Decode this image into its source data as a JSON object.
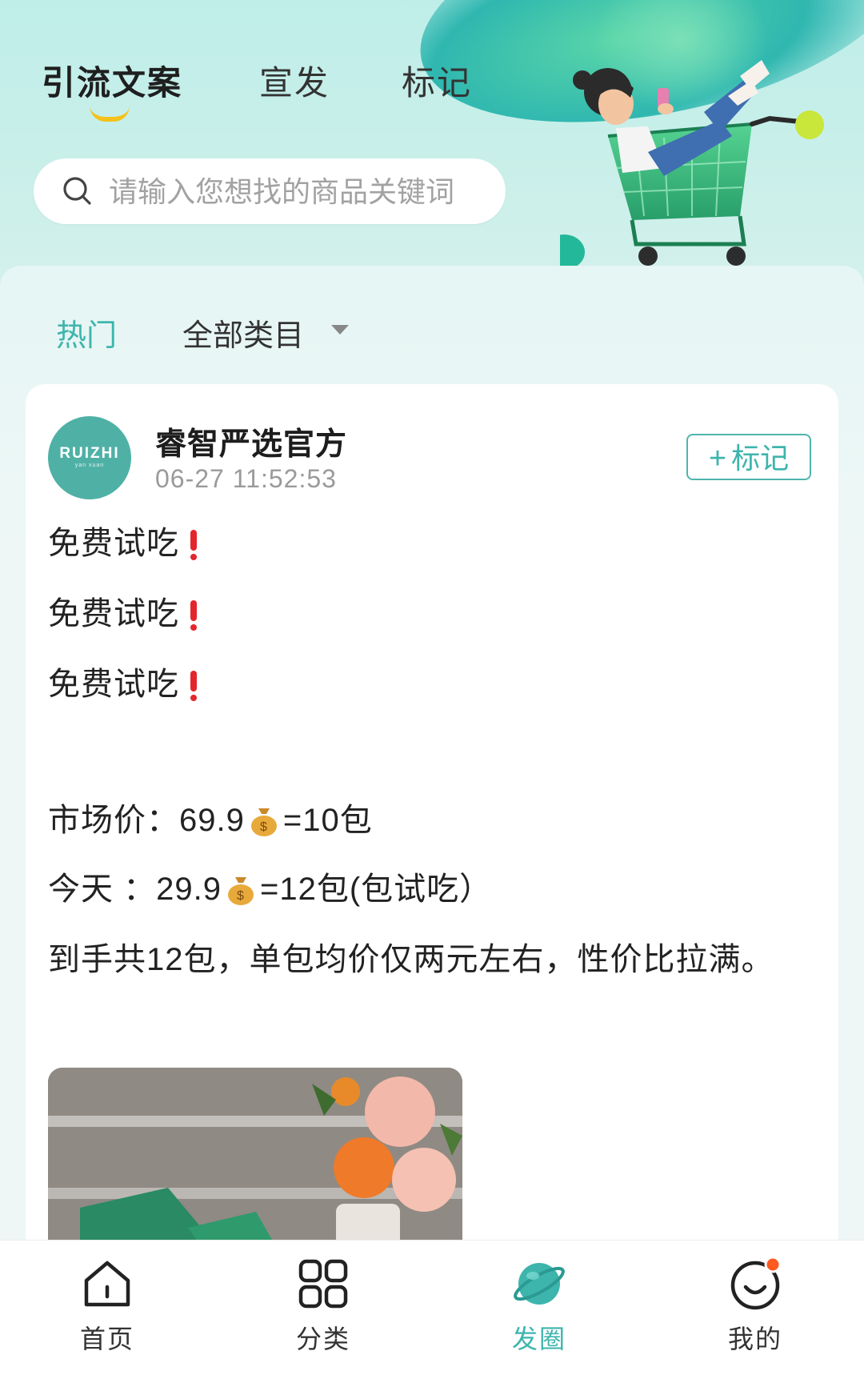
{
  "header": {
    "tabs": [
      {
        "label": "引流文案",
        "active": true
      },
      {
        "label": "宣发",
        "active": false
      },
      {
        "label": "标记",
        "active": false
      }
    ],
    "search": {
      "placeholder": "请输入您想找的商品关键词"
    },
    "colors": {
      "accent": "#3db5ad",
      "tab_indicator": "#f4c21b"
    }
  },
  "filters": {
    "hot_label": "热门",
    "category_label": "全部类目"
  },
  "post": {
    "avatar": {
      "brand": "RUIZHI",
      "sub": "yan xuan"
    },
    "author": "睿智严选官方",
    "time": "06-27 11:52:53",
    "mark_button": {
      "icon": "+",
      "label": "标记"
    },
    "lines": [
      {
        "text": "免费试吃",
        "suffix": "exclamation-icon"
      },
      {
        "text": "免费试吃",
        "suffix": "exclamation-icon"
      },
      {
        "text": "免费试吃",
        "suffix": "exclamation-icon"
      },
      {
        "before": "市场价：69.9",
        "after": "=10包"
      },
      {
        "before": "今天 ：29.9",
        "after": "=12包(包试吃）"
      },
      {
        "text": "到手共12包，单包均价仅两元左右，性价比拉满。"
      }
    ]
  },
  "bottom_nav": {
    "items": [
      {
        "label": "首页",
        "icon": "home-icon",
        "active": false
      },
      {
        "label": "分类",
        "icon": "grid-icon",
        "active": false
      },
      {
        "label": "发圈",
        "icon": "planet-icon",
        "active": true
      },
      {
        "label": "我的",
        "icon": "smile-icon",
        "active": false,
        "badge_color": "#ff5a1f"
      }
    ]
  }
}
